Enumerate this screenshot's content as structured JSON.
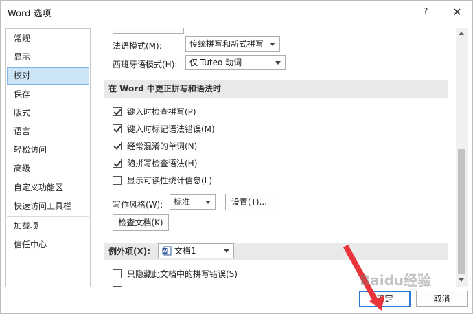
{
  "window": {
    "title": "Word 选项",
    "help_label": "?",
    "close_label": "✕"
  },
  "sidebar": {
    "items": [
      {
        "label": "常规"
      },
      {
        "label": "显示"
      },
      {
        "label": "校对",
        "selected": true
      },
      {
        "label": "保存"
      },
      {
        "label": "版式"
      },
      {
        "label": "语言"
      },
      {
        "label": "轻松访问"
      },
      {
        "label": "高级"
      },
      {
        "label": "自定义功能区"
      },
      {
        "label": "快速访问工具栏"
      },
      {
        "label": "加载项"
      },
      {
        "label": "信任中心"
      }
    ]
  },
  "content": {
    "french_mode": {
      "label": "法语模式(M):",
      "value": "传统拼写和新式拼写"
    },
    "spanish_mode": {
      "label": "西班牙语模式(H):",
      "value": "仅 Tuteo 动词"
    },
    "section_word": {
      "title": "在 Word 中更正拼写和语法时"
    },
    "checks": [
      {
        "label": "键入时检查拼写(P)",
        "checked": true
      },
      {
        "label": "键入时标记语法错误(M)",
        "checked": true
      },
      {
        "label": "经常混淆的单词(N)",
        "checked": true
      },
      {
        "label": "随拼写检查语法(H)",
        "checked": true
      },
      {
        "label": "显示可读性统计信息(L)",
        "checked": false
      }
    ],
    "writing_style": {
      "label": "写作风格(W):",
      "value": "标准",
      "settings_button": "设置(T)..."
    },
    "check_document_button": "检查文档(K)",
    "section_exceptions": {
      "title": "例外项(X):",
      "document": "文档1"
    },
    "exception_checks": [
      {
        "label": "只隐藏此文档中的拼写错误(S)",
        "checked": false
      }
    ]
  },
  "footer": {
    "ok_label": "确定",
    "cancel_label": "取消"
  },
  "watermark": {
    "text": "Baidu经验"
  },
  "colors": {
    "accent": "#2b79d3",
    "selection": "#cde6f7",
    "annotation_arrow": "#e8343a"
  }
}
